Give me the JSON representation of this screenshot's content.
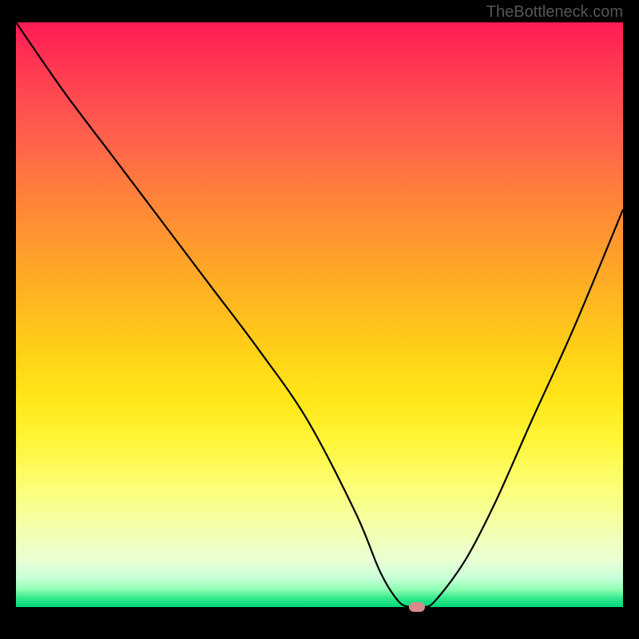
{
  "watermark": "TheBottleneck.com",
  "chart_data": {
    "type": "line",
    "title": "",
    "xlabel": "",
    "ylabel": "",
    "xlim": [
      0,
      100
    ],
    "ylim": [
      0,
      100
    ],
    "series": [
      {
        "name": "bottleneck-curve",
        "x": [
          0,
          8,
          16,
          24,
          32,
          40,
          48,
          56,
          60,
          63,
          65,
          67,
          69,
          74,
          79,
          85,
          92,
          100
        ],
        "values": [
          100,
          88,
          77,
          66,
          55,
          44,
          32,
          16,
          6,
          1,
          0,
          0,
          1,
          8,
          18,
          32,
          48,
          68
        ]
      }
    ],
    "marker": {
      "x": 66,
      "y": 0
    },
    "gradient_colors": {
      "top": "#ff1a55",
      "mid": "#ffd317",
      "bottom": "#00d97a"
    }
  }
}
